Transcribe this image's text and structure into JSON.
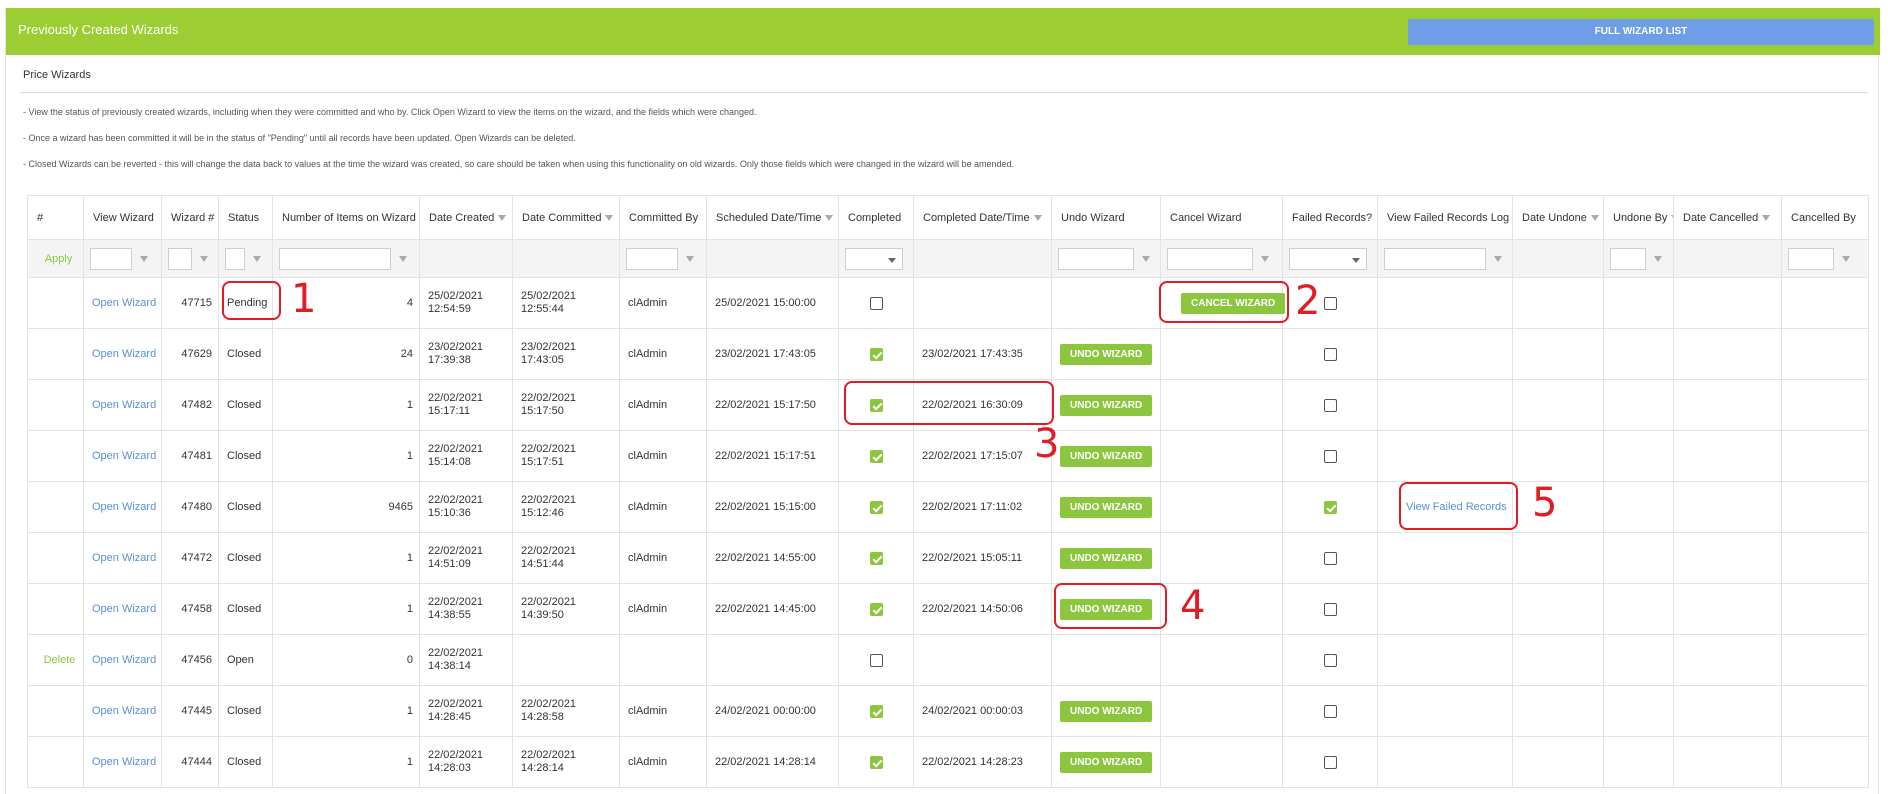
{
  "header": {
    "title": "Previously Created Wizards",
    "full_list_label": "FULL WIZARD LIST"
  },
  "section_title": "Price Wizards",
  "info": [
    "- View the status of previously created wizards, including when they were committed and who by. Click Open Wizard to view the items on the wizard, and the fields which were changed.",
    "- Once a wizard has been committed it will be in the status of \"Pending\" until all records have been updated. Open Wizards can be deleted.",
    "- Closed Wizards can be reverted - this will change the data back to values at the time the wizard was created, so care should be taken when using this functionality on old wizards. Only those fields which were changed in the wizard will be amended."
  ],
  "columns": [
    "#",
    "View Wizard",
    "Wizard #",
    "Status",
    "Number of Items on Wizard",
    "Date Created",
    "Date Committed",
    "Committed By",
    "Scheduled Date/Time",
    "Completed",
    "Completed Date/Time",
    "Undo Wizard",
    "Cancel Wizard",
    "Failed Records?",
    "View Failed Records Log",
    "Date Undone",
    "Undone By",
    "Date Cancelled",
    "Cancelled By"
  ],
  "apply_label": "Apply",
  "rows": [
    {
      "action": "",
      "view": "Open Wizard",
      "num": "47715",
      "status": "Pending",
      "items": "4",
      "created": [
        "25/02/2021",
        "12:54:59"
      ],
      "committed": [
        "25/02/2021",
        "12:55:44"
      ],
      "by": "clAdmin",
      "scheduled": "25/02/2021 15:00:00",
      "completed": false,
      "completed_dt": "",
      "undo": "",
      "cancel": "CANCEL WIZARD",
      "failed": false,
      "log": ""
    },
    {
      "action": "",
      "view": "Open Wizard",
      "num": "47629",
      "status": "Closed",
      "items": "24",
      "created": [
        "23/02/2021",
        "17:39:38"
      ],
      "committed": [
        "23/02/2021",
        "17:43:05"
      ],
      "by": "clAdmin",
      "scheduled": "23/02/2021 17:43:05",
      "completed": true,
      "completed_dt": "23/02/2021 17:43:35",
      "undo": "UNDO WIZARD",
      "cancel": "",
      "failed": false,
      "log": ""
    },
    {
      "action": "",
      "view": "Open Wizard",
      "num": "47482",
      "status": "Closed",
      "items": "1",
      "created": [
        "22/02/2021",
        "15:17:11"
      ],
      "committed": [
        "22/02/2021",
        "15:17:50"
      ],
      "by": "clAdmin",
      "scheduled": "22/02/2021 15:17:50",
      "completed": true,
      "completed_dt": "22/02/2021 16:30:09",
      "undo": "UNDO WIZARD",
      "cancel": "",
      "failed": false,
      "log": ""
    },
    {
      "action": "",
      "view": "Open Wizard",
      "num": "47481",
      "status": "Closed",
      "items": "1",
      "created": [
        "22/02/2021",
        "15:14:08"
      ],
      "committed": [
        "22/02/2021",
        "15:17:51"
      ],
      "by": "clAdmin",
      "scheduled": "22/02/2021 15:17:51",
      "completed": true,
      "completed_dt": "22/02/2021 17:15:07",
      "undo": "UNDO WIZARD",
      "cancel": "",
      "failed": false,
      "log": ""
    },
    {
      "action": "",
      "view": "Open Wizard",
      "num": "47480",
      "status": "Closed",
      "items": "9465",
      "created": [
        "22/02/2021",
        "15:10:36"
      ],
      "committed": [
        "22/02/2021",
        "15:12:46"
      ],
      "by": "clAdmin",
      "scheduled": "22/02/2021 15:15:00",
      "completed": true,
      "completed_dt": "22/02/2021 17:11:02",
      "undo": "UNDO WIZARD",
      "cancel": "",
      "failed": true,
      "log": "View Failed Records"
    },
    {
      "action": "",
      "view": "Open Wizard",
      "num": "47472",
      "status": "Closed",
      "items": "1",
      "created": [
        "22/02/2021",
        "14:51:09"
      ],
      "committed": [
        "22/02/2021",
        "14:51:44"
      ],
      "by": "clAdmin",
      "scheduled": "22/02/2021 14:55:00",
      "completed": true,
      "completed_dt": "22/02/2021 15:05:11",
      "undo": "UNDO WIZARD",
      "cancel": "",
      "failed": false,
      "log": ""
    },
    {
      "action": "",
      "view": "Open Wizard",
      "num": "47458",
      "status": "Closed",
      "items": "1",
      "created": [
        "22/02/2021",
        "14:38:55"
      ],
      "committed": [
        "22/02/2021",
        "14:39:50"
      ],
      "by": "clAdmin",
      "scheduled": "22/02/2021 14:45:00",
      "completed": true,
      "completed_dt": "22/02/2021 14:50:06",
      "undo": "UNDO WIZARD",
      "cancel": "",
      "failed": false,
      "log": ""
    },
    {
      "action": "Delete",
      "view": "Open Wizard",
      "num": "47456",
      "status": "Open",
      "items": "0",
      "created": [
        "22/02/2021",
        "14:38:14"
      ],
      "committed": [
        "",
        ""
      ],
      "by": "",
      "scheduled": "",
      "completed": false,
      "completed_dt": "",
      "undo": "",
      "cancel": "",
      "failed": false,
      "log": ""
    },
    {
      "action": "",
      "view": "Open Wizard",
      "num": "47445",
      "status": "Closed",
      "items": "1",
      "created": [
        "22/02/2021",
        "14:28:45"
      ],
      "committed": [
        "22/02/2021",
        "14:28:58"
      ],
      "by": "clAdmin",
      "scheduled": "24/02/2021 00:00:00",
      "completed": true,
      "completed_dt": "24/02/2021 00:00:03",
      "undo": "UNDO WIZARD",
      "cancel": "",
      "failed": false,
      "log": ""
    },
    {
      "action": "",
      "view": "Open Wizard",
      "num": "47444",
      "status": "Closed",
      "items": "1",
      "created": [
        "22/02/2021",
        "14:28:03"
      ],
      "committed": [
        "22/02/2021",
        "14:28:14"
      ],
      "by": "clAdmin",
      "scheduled": "22/02/2021 14:28:14",
      "completed": true,
      "completed_dt": "22/02/2021 14:28:23",
      "undo": "UNDO WIZARD",
      "cancel": "",
      "failed": false,
      "log": ""
    }
  ],
  "annotations": [
    "1",
    "2",
    "3",
    "4",
    "5"
  ],
  "colors": {
    "header_green": "#9ccd33",
    "button_green": "#8cc63f",
    "blue_button": "#6e9ee8",
    "annotation_red": "#e31b23",
    "link_blue": "#5b8fd6"
  }
}
